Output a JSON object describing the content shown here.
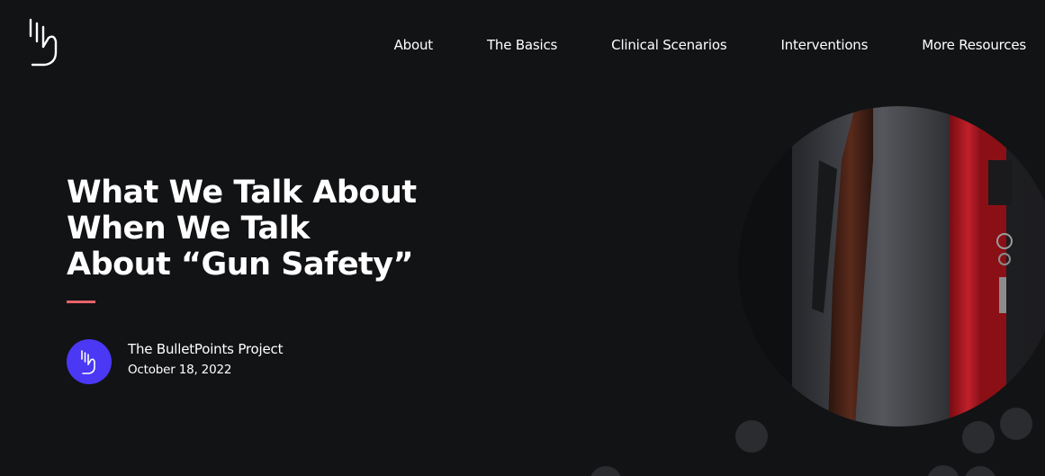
{
  "nav": {
    "items": [
      "About",
      "The Basics",
      "Clinical Scenarios",
      "Interventions",
      "More Resources"
    ]
  },
  "article": {
    "title_lines": [
      "What We Talk About",
      "When We Talk",
      "About “Gun Safety”"
    ],
    "author": "The BulletPoints Project",
    "date": "October 18, 2022"
  },
  "colors": {
    "background": "#121315",
    "accent": "#e8636b",
    "avatar": "#4a38f5"
  },
  "icons": {
    "logo": "bulletpoints-hand-logo-icon",
    "avatar": "bulletpoints-hand-logo-icon"
  }
}
